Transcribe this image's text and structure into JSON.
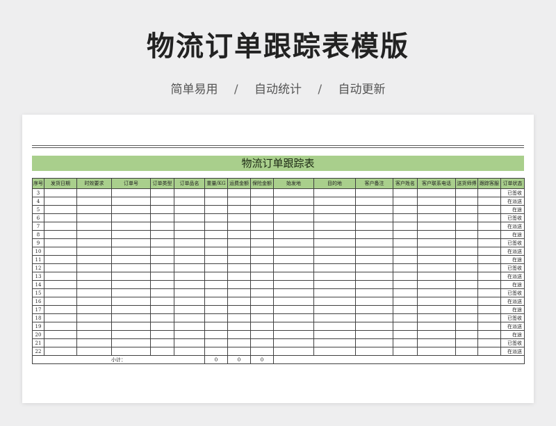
{
  "page": {
    "title": "物流订单跟踪表模版",
    "tags": [
      "简单易用",
      "自动统计",
      "自动更新"
    ],
    "separator": "/"
  },
  "sheet": {
    "banner_title": "物流订单跟踪表",
    "columns": [
      "序号",
      "发货日期",
      "时效要求",
      "订单号",
      "订单类型",
      "订单品名",
      "重量/KG",
      "运费金额",
      "保险金额",
      "始发地",
      "目的地",
      "客户备注",
      "客户姓名",
      "客户联系电话",
      "送货师傅",
      "跟踪客服",
      "订单状态"
    ],
    "rows": [
      {
        "no": "3",
        "status": "已签收"
      },
      {
        "no": "4",
        "status": "在派送"
      },
      {
        "no": "5",
        "status": "在途"
      },
      {
        "no": "6",
        "status": "已签收"
      },
      {
        "no": "7",
        "status": "在派送"
      },
      {
        "no": "8",
        "status": "在途"
      },
      {
        "no": "9",
        "status": "已签收"
      },
      {
        "no": "10",
        "status": "在派送"
      },
      {
        "no": "11",
        "status": "在途"
      },
      {
        "no": "12",
        "status": "已签收"
      },
      {
        "no": "13",
        "status": "在派送"
      },
      {
        "no": "14",
        "status": "在途"
      },
      {
        "no": "15",
        "status": "已签收"
      },
      {
        "no": "16",
        "status": "在派送"
      },
      {
        "no": "17",
        "status": "在途"
      },
      {
        "no": "18",
        "status": "已签收"
      },
      {
        "no": "19",
        "status": "在派送"
      },
      {
        "no": "20",
        "status": "在途"
      },
      {
        "no": "21",
        "status": "已签收"
      },
      {
        "no": "22",
        "status": "在派送"
      }
    ],
    "subtotal": {
      "label": "小计：",
      "weight": "0",
      "freight": "0",
      "insurance": "0"
    }
  }
}
